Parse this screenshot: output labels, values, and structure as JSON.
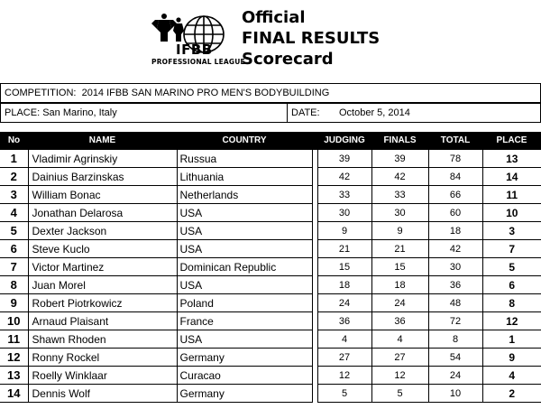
{
  "logo": {
    "brand": "IFBB",
    "subtitle": "PROFESSIONAL LEAGUE"
  },
  "title": {
    "line1": "Official",
    "line2": "FINAL RESULTS",
    "line3": "Scorecard"
  },
  "competition": {
    "label": "COMPETITION:",
    "value": "2014 IFBB SAN MARINO PRO MEN'S BODYBUILDING"
  },
  "place": {
    "label": "PLACE:",
    "value": "San Marino, Italy"
  },
  "date": {
    "label": "DATE:",
    "value": "October 5, 2014"
  },
  "columns": {
    "no": "No",
    "name": "NAME",
    "country": "COUNTRY",
    "judging": "JUDGING",
    "finals": "FINALS",
    "total": "TOTAL",
    "place": "PLACE"
  },
  "rows": [
    {
      "no": "1",
      "name": "Vladimir Agrinskiy",
      "country": "Russua",
      "judging": "39",
      "finals": "39",
      "total": "78",
      "place": "13"
    },
    {
      "no": "2",
      "name": "Dainius Barzinskas",
      "country": "Lithuania",
      "judging": "42",
      "finals": "42",
      "total": "84",
      "place": "14"
    },
    {
      "no": "3",
      "name": "William Bonac",
      "country": "Netherlands",
      "judging": "33",
      "finals": "33",
      "total": "66",
      "place": "11"
    },
    {
      "no": "4",
      "name": "Jonathan Delarosa",
      "country": "USA",
      "judging": "30",
      "finals": "30",
      "total": "60",
      "place": "10"
    },
    {
      "no": "5",
      "name": "Dexter Jackson",
      "country": "USA",
      "judging": "9",
      "finals": "9",
      "total": "18",
      "place": "3"
    },
    {
      "no": "6",
      "name": "Steve Kuclo",
      "country": "USA",
      "judging": "21",
      "finals": "21",
      "total": "42",
      "place": "7"
    },
    {
      "no": "7",
      "name": "Victor Martinez",
      "country": "Dominican Republic",
      "judging": "15",
      "finals": "15",
      "total": "30",
      "place": "5"
    },
    {
      "no": "8",
      "name": "Juan Morel",
      "country": "USA",
      "judging": "18",
      "finals": "18",
      "total": "36",
      "place": "6"
    },
    {
      "no": "9",
      "name": "Robert Piotrkowicz",
      "country": "Poland",
      "judging": "24",
      "finals": "24",
      "total": "48",
      "place": "8"
    },
    {
      "no": "10",
      "name": "Arnaud Plaisant",
      "country": "France",
      "judging": "36",
      "finals": "36",
      "total": "72",
      "place": "12"
    },
    {
      "no": "11",
      "name": "Shawn Rhoden",
      "country": "USA",
      "judging": "4",
      "finals": "4",
      "total": "8",
      "place": "1"
    },
    {
      "no": "12",
      "name": "Ronny Rockel",
      "country": "Germany",
      "judging": "27",
      "finals": "27",
      "total": "54",
      "place": "9"
    },
    {
      "no": "13",
      "name": "Roelly Winklaar",
      "country": "Curacao",
      "judging": "12",
      "finals": "12",
      "total": "24",
      "place": "4"
    },
    {
      "no": "14",
      "name": "Dennis Wolf",
      "country": "Germany",
      "judging": "5",
      "finals": "5",
      "total": "10",
      "place": "2"
    }
  ]
}
